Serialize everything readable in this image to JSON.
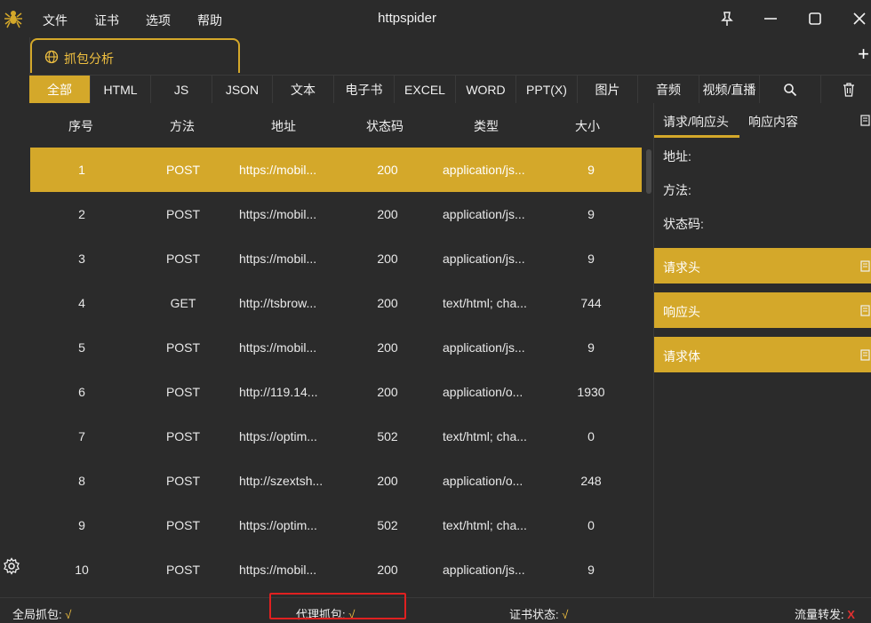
{
  "app": {
    "title": "httpspider",
    "menu": [
      "文件",
      "证书",
      "选项",
      "帮助"
    ]
  },
  "tab": {
    "label": "抓包分析"
  },
  "filters": [
    "全部",
    "HTML",
    "JS",
    "JSON",
    "文本",
    "电子书",
    "EXCEL",
    "WORD",
    "PPT(X)",
    "图片",
    "音频",
    "视频/直播"
  ],
  "table": {
    "headers": [
      "序号",
      "方法",
      "地址",
      "状态码",
      "类型",
      "大小"
    ],
    "rows": [
      [
        "1",
        "POST",
        "https://mobil...",
        "200",
        "application/js...",
        "9"
      ],
      [
        "2",
        "POST",
        "https://mobil...",
        "200",
        "application/js...",
        "9"
      ],
      [
        "3",
        "POST",
        "https://mobil...",
        "200",
        "application/js...",
        "9"
      ],
      [
        "4",
        "GET",
        "http://tsbrow...",
        "200",
        "text/html; cha...",
        "744"
      ],
      [
        "5",
        "POST",
        "https://mobil...",
        "200",
        "application/js...",
        "9"
      ],
      [
        "6",
        "POST",
        "http://119.14...",
        "200",
        "application/o...",
        "1930"
      ],
      [
        "7",
        "POST",
        "https://optim...",
        "502",
        "text/html; cha...",
        "0"
      ],
      [
        "8",
        "POST",
        "http://szextsh...",
        "200",
        "application/o...",
        "248"
      ],
      [
        "9",
        "POST",
        "https://optim...",
        "502",
        "text/html; cha...",
        "0"
      ],
      [
        "10",
        "POST",
        "https://mobil...",
        "200",
        "application/js...",
        "9"
      ]
    ]
  },
  "right_panel": {
    "tabs": [
      "请求/响应头",
      "响应内容"
    ],
    "fields": [
      "地址:",
      "方法:",
      "状态码:"
    ],
    "sections": [
      "请求头",
      "响应头",
      "请求体"
    ]
  },
  "status_bar": {
    "global_capture": {
      "label": "全局抓包:",
      "value": "√"
    },
    "proxy_capture": {
      "label": "代理抓包:",
      "value": "√"
    },
    "cert_status": {
      "label": "证书状态:",
      "value": "√"
    },
    "traffic_forward": {
      "label": "流量转发:",
      "value": "X"
    }
  },
  "colors": {
    "accent": "#d4a82a",
    "background": "#2b2b2b",
    "error": "#e03030"
  }
}
